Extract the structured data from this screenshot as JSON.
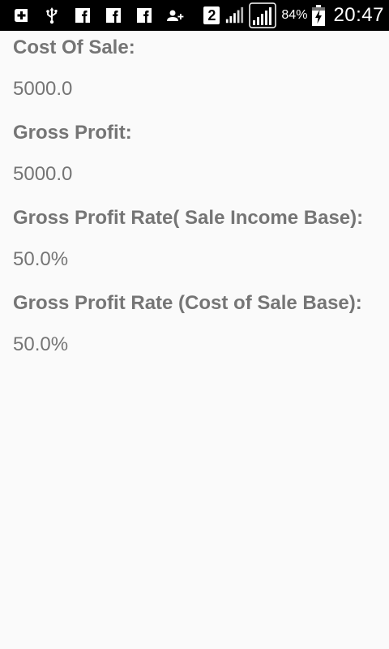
{
  "status_bar": {
    "icons_left": [
      "add-box-icon",
      "usb-icon",
      "facebook-icon",
      "facebook-icon",
      "facebook-icon",
      "add-person-icon"
    ],
    "sim_slot": "2",
    "battery_percent": "84%",
    "time": "20:47"
  },
  "sections": [
    {
      "label": "Cost Of Sale:",
      "value": "5000.0"
    },
    {
      "label": "Gross Profit:",
      "value": "5000.0"
    },
    {
      "label": "Gross Profit Rate( Sale Income Base):",
      "value": "50.0%"
    },
    {
      "label": "Gross Profit Rate (Cost of Sale Base):",
      "value": "50.0%"
    }
  ]
}
